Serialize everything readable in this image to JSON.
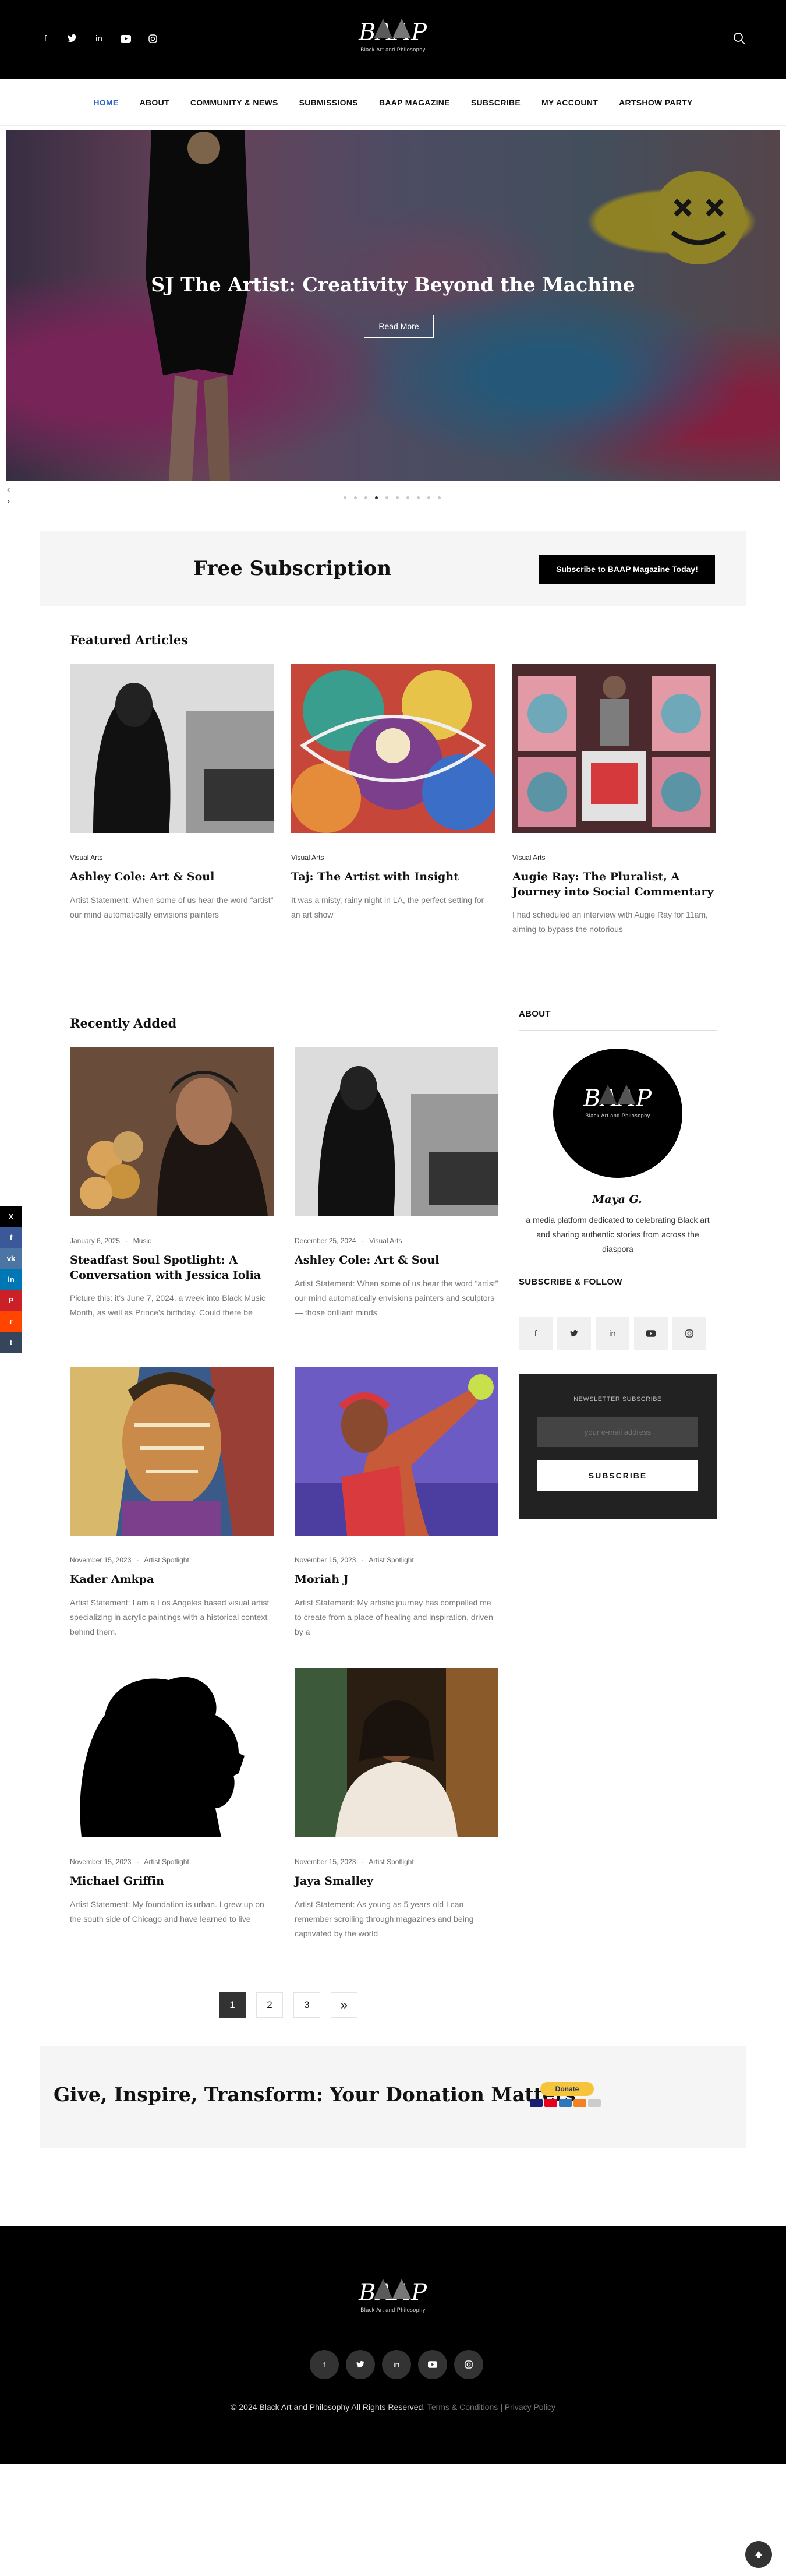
{
  "header": {
    "brand": "BAAP",
    "tagline": "Black Art and Philosophy",
    "social_icons": [
      "facebook-icon",
      "twitter-icon",
      "linkedin-icon",
      "youtube-icon",
      "instagram-icon"
    ]
  },
  "nav": {
    "items": [
      {
        "label": "HOME",
        "active": true
      },
      {
        "label": "ABOUT"
      },
      {
        "label": "COMMUNITY & NEWS"
      },
      {
        "label": "SUBMISSIONS"
      },
      {
        "label": "BAAP MAGAZINE"
      },
      {
        "label": "SUBSCRIBE"
      },
      {
        "label": "MY ACCOUNT"
      },
      {
        "label": "ARTSHOW PARTY"
      }
    ]
  },
  "hero": {
    "title": "SJ The Artist: Creativity Beyond the Machine",
    "button": "Read More",
    "slide_count": 10,
    "active_slide": 4
  },
  "subscription": {
    "title": "Free Subscription",
    "button": "Subscribe to BAAP Magazine Today!"
  },
  "featured": {
    "title": "Featured Articles",
    "items": [
      {
        "category": "Visual Arts",
        "title": "Ashley Cole: Art & Soul",
        "excerpt": "Artist Statement: When some of us hear the word “artist” our mind automatically envisions painters"
      },
      {
        "category": "Visual Arts",
        "title": "Taj: The Artist with Insight",
        "excerpt": "It was a misty, rainy night in LA, the perfect setting for an art show"
      },
      {
        "category": "Visual Arts",
        "title": "Augie Ray: The Pluralist, A Journey into Social Commentary",
        "excerpt": "I had scheduled an interview with Augie Ray for 11am, aiming to bypass the notorious"
      }
    ]
  },
  "recent": {
    "title": "Recently Added",
    "items": [
      {
        "date": "January 6, 2025",
        "category": "Music",
        "title": "Steadfast Soul Spotlight: A Conversation with Jessica Iolia",
        "excerpt": "Picture this: it’s June 7, 2024, a week into Black Music Month, as well as Prince’s birthday. Could there be"
      },
      {
        "date": "December 25, 2024",
        "category": "Visual Arts",
        "title": "Ashley Cole: Art & Soul",
        "excerpt": "Artist Statement: When some of us hear the word “artist” our mind automatically envisions painters and sculptors— those brilliant minds"
      },
      {
        "date": "November 15, 2023",
        "category": "Artist Spotlight",
        "title": "Kader Amkpa",
        "excerpt": "Artist Statement: I am a Los Angeles based visual artist specializing in acrylic paintings with a historical context behind them."
      },
      {
        "date": "November 15, 2023",
        "category": "Artist Spotlight",
        "title": "Moriah J",
        "excerpt": "Artist Statement: My artistic journey has compelled me to create from a place of healing and inspiration, driven by a"
      },
      {
        "date": "November 15, 2023",
        "category": "Artist Spotlight",
        "title": "Michael Griffin",
        "excerpt": "Artist Statement: My foundation is urban. I grew up on the south side of Chicago and have learned to live"
      },
      {
        "date": "November 15, 2023",
        "category": "Artist Spotlight",
        "title": "Jaya Smalley",
        "excerpt": "Artist Statement: As young as 5 years old I can remember scrolling through magazines and being captivated by the world"
      }
    ]
  },
  "sidebar": {
    "about_title": "ABOUT",
    "signature": "Maya G.",
    "about_text": "a media platform dedicated to celebrating Black art and sharing authentic stories from across the diaspora",
    "follow_title": "SUBSCRIBE & FOLLOW",
    "newsletter_label": "NEWSLETTER SUBSCRIBE",
    "newsletter_placeholder": "your e-mail address",
    "newsletter_button": "SUBSCRIBE"
  },
  "pagination": {
    "pages": [
      "1",
      "2",
      "3"
    ],
    "next": "»"
  },
  "donation": {
    "title": "Give, Inspire, Transform: Your Donation Matters",
    "button": "Donate"
  },
  "footer": {
    "copyright": "© 2024 Black Art and Philosophy All Rights Reserved.",
    "terms": "Terms & Conditions",
    "sep": "|",
    "privacy": "Privacy Policy"
  },
  "colors": {
    "accent": "#2a63c7",
    "header_bg": "#000000",
    "paypal_yellow": "#f6c43a"
  }
}
